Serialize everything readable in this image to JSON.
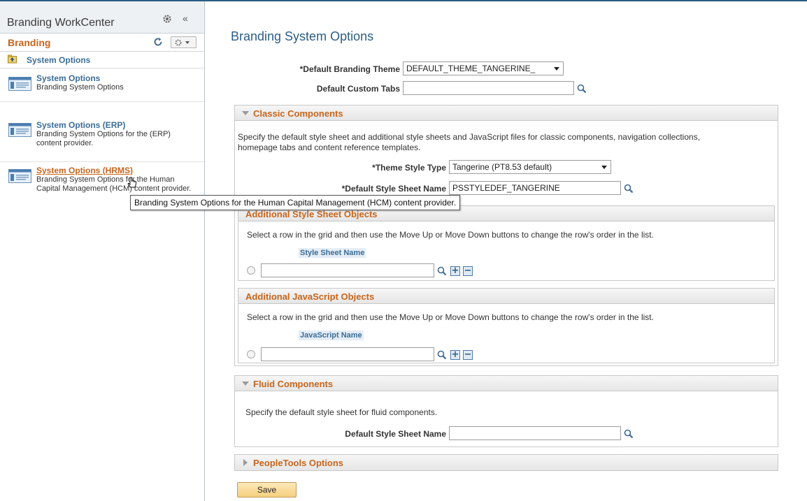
{
  "workcenter": {
    "title": "Branding WorkCenter",
    "pagelet_title": "Branding",
    "back_link": "System Options",
    "items": [
      {
        "label": "System Options",
        "description": [
          "Branding System Options"
        ]
      },
      {
        "label": "System Options (ERP)",
        "description": [
          "Branding System Options for the (ERP)",
          "content provider."
        ]
      },
      {
        "label": "System Options (HRMS)",
        "description": [
          "Branding System Options for the Human",
          "Capital Management (HCM) content provider."
        ]
      }
    ]
  },
  "tooltip": "Branding System Options for the Human Capital Management (HCM) content provider.",
  "page": {
    "title": "Branding System Options",
    "default_branding_theme": {
      "label": "*Default Branding Theme",
      "value": "DEFAULT_THEME_TANGERINE_"
    },
    "default_custom_tabs": {
      "label": "Default Custom Tabs",
      "value": ""
    },
    "classic": {
      "title": "Classic Components",
      "description": [
        "Specify the default style sheet and additional style sheets and JavaScript files for classic components, navigation collections,",
        "homepage tabs and content reference templates."
      ],
      "theme_style_type": {
        "label": "*Theme Style Type",
        "value": "Tangerine (PT8.53 default)"
      },
      "default_style_sheet": {
        "label": "*Default Style Sheet Name",
        "value": "PSSTYLEDEF_TANGERINE"
      },
      "additional_style_sheets": {
        "title": "Additional Style Sheet Objects",
        "instructions": "Select a row in the grid and then use the Move Up or Move Down buttons to change the row's order in the list.",
        "column": "Style Sheet Name",
        "value": ""
      },
      "additional_javascript": {
        "title": "Additional JavaScript Objects",
        "instructions": "Select a row in the grid and then use the Move Up or Move Down buttons to change the row's order in the list.",
        "column": "JavaScript Name",
        "value": ""
      }
    },
    "fluid": {
      "title": "Fluid Components",
      "description": "Specify the default style sheet for fluid components.",
      "default_style_sheet": {
        "label": "Default Style Sheet Name",
        "value": ""
      }
    },
    "peopletools": {
      "title": "PeopleTools Options"
    },
    "save_label": "Save"
  },
  "icons": {
    "plus": "+",
    "minus": "−",
    "collapse": "«"
  },
  "colors": {
    "link": "#3b6d98",
    "accent": "#c8651b",
    "title": "#2c5d84",
    "save_button": "#f5cf7e"
  }
}
